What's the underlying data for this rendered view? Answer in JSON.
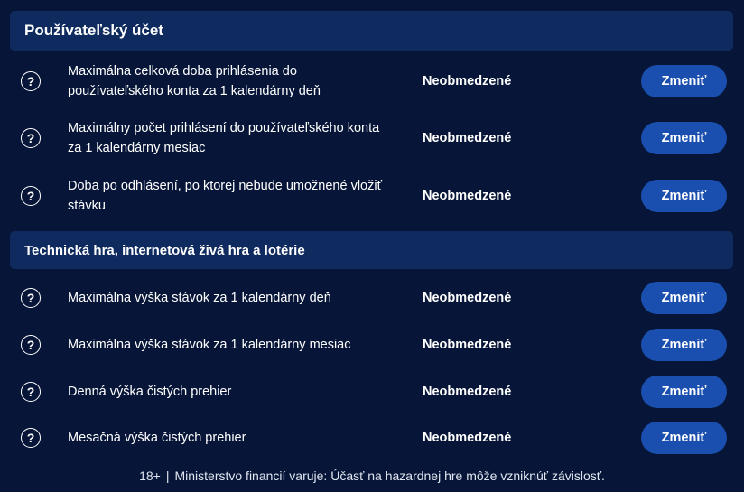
{
  "sections": [
    {
      "title": "Používateľský účet",
      "rows": [
        {
          "label": "Maximálna celková doba prihlásenia do používateľského konta za 1 kalendárny deň",
          "value": "Neobmedzené",
          "button": "Zmeniť"
        },
        {
          "label": "Maximálny počet prihlásení do používateľského konta za 1 kalendárny mesiac",
          "value": "Neobmedzené",
          "button": "Zmeniť"
        },
        {
          "label": "Doba po odhlásení, po ktorej nebude umožnené vložiť stávku",
          "value": "Neobmedzené",
          "button": "Zmeniť"
        }
      ]
    },
    {
      "title": "Technická hra, internetová živá hra a lotérie",
      "rows": [
        {
          "label": "Maximálna výška stávok za 1 kalendárny deň",
          "value": "Neobmedzené",
          "button": "Zmeniť"
        },
        {
          "label": "Maximálna výška stávok za 1 kalendárny mesiac",
          "value": "Neobmedzené",
          "button": "Zmeniť"
        },
        {
          "label": "Denná výška čistých prehier",
          "value": "Neobmedzené",
          "button": "Zmeniť"
        },
        {
          "label": "Mesačná výška čistých prehier",
          "value": "Neobmedzené",
          "button": "Zmeniť"
        }
      ]
    }
  ],
  "help_icon": "?",
  "footer": {
    "age": "18+",
    "separator": "|",
    "warning": "Ministerstvo financií varuje: Účasť na hazardnej hre môže vzniknúť závislosť."
  },
  "colors": {
    "background": "#071638",
    "section_header": "#0e2a5e",
    "button": "#1a4fb0"
  },
  "icons": {
    "help": "question-circle-icon"
  }
}
